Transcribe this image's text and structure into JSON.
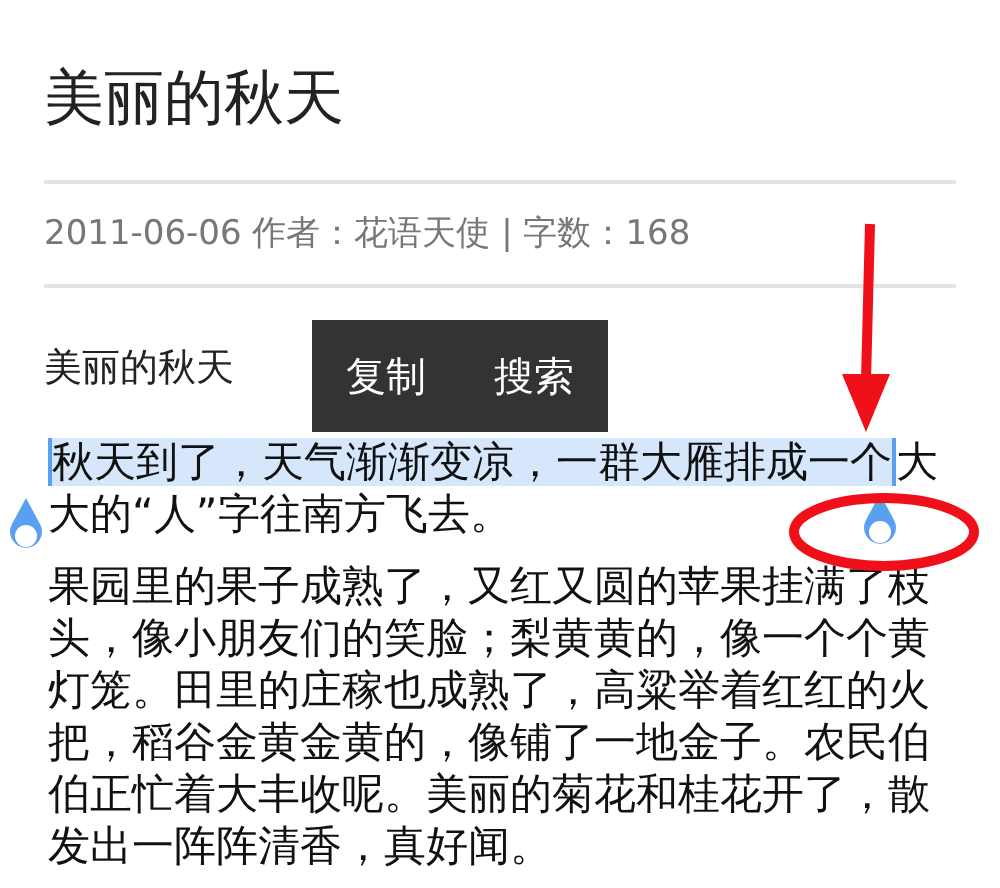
{
  "article": {
    "title": "美丽的秋天",
    "meta": "2011-06-06 作者：花语天使 | 字数：168",
    "subtitle": "美丽的秋天",
    "paragraphs": [
      {
        "selected_text": "秋天到了，天气渐渐变凉，一群大雁排成一个",
        "text": "大大的“人”字往南方飞去。"
      },
      {
        "text": "果园里的果子成熟了，又红又圆的苹果挂满了枝头，像小朋友们的笑脸；梨黄黄的，像一个个黄灯笼。田里的庄稼也成熟了，高粱举着红红的火把，稻谷金黄金黄的，像铺了一地金子。农民伯伯正忙着大丰收呢。美丽的菊花和桂花开了，散发出一阵阵清香，真好闻。"
      }
    ]
  },
  "context_menu": {
    "items": [
      "复制",
      "搜索"
    ]
  }
}
